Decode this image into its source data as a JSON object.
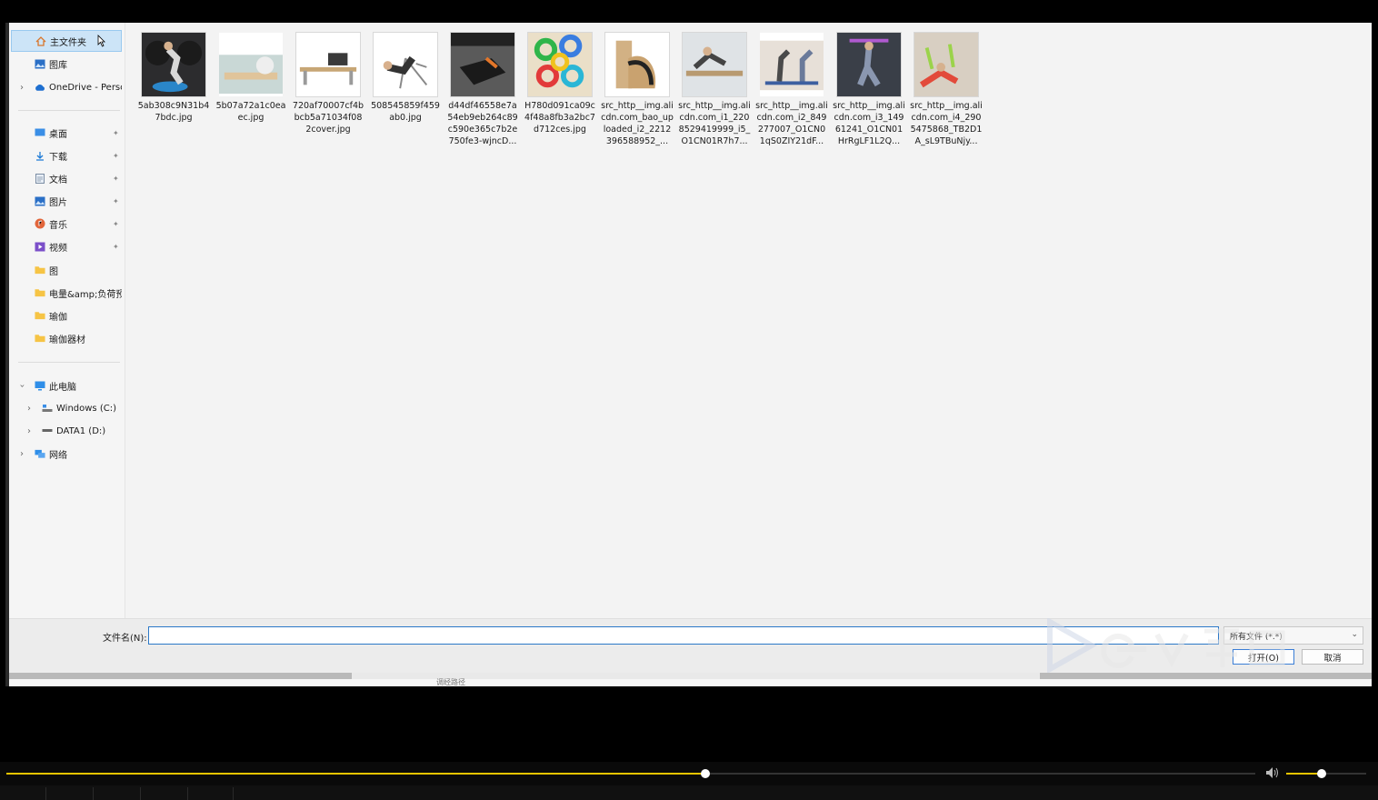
{
  "nav": {
    "quick": [
      {
        "label": "主文件夹",
        "icon": "home-icon"
      },
      {
        "label": "图库",
        "icon": "gallery-icon"
      },
      {
        "label": "OneDrive - Perso",
        "icon": "cloud-icon"
      }
    ],
    "pinned": [
      {
        "label": "桌面",
        "icon": "desktop-icon"
      },
      {
        "label": "下载",
        "icon": "download-icon"
      },
      {
        "label": "文档",
        "icon": "document-icon"
      },
      {
        "label": "图片",
        "icon": "pictures-icon"
      },
      {
        "label": "音乐",
        "icon": "music-icon"
      },
      {
        "label": "视频",
        "icon": "video-icon"
      },
      {
        "label": "图",
        "icon": "folder-icon"
      },
      {
        "label": "电量&amp;负荷预",
        "icon": "folder-icon"
      },
      {
        "label": "瑜伽",
        "icon": "folder-icon"
      },
      {
        "label": "瑜伽器材",
        "icon": "folder-icon"
      }
    ],
    "pc": [
      {
        "label": "此电脑",
        "icon": "computer-icon"
      },
      {
        "label": "Windows (C:)",
        "icon": "drive-icon"
      },
      {
        "label": "DATA1 (D:)",
        "icon": "drive-icon"
      },
      {
        "label": "网络",
        "icon": "network-icon"
      }
    ]
  },
  "files": [
    {
      "name": "5ab308c9N31b47bdc.jpg"
    },
    {
      "name": "5b07a72a1c0eaec.jpg"
    },
    {
      "name": "720af70007cf4bbcb5a71034f082cover.jpg"
    },
    {
      "name": "508545859f459ab0.jpg"
    },
    {
      "name": "d44df46558e7a54eb9eb264c89c590e365c7b2e750fe3-wjncD..."
    },
    {
      "name": "H780d091ca09c4f48a8fb3a2bc7d712ces.jpg"
    },
    {
      "name": "src_http__img.alicdn.com_bao_uploaded_i2_2212396588952_..."
    },
    {
      "name": "src_http__img.alicdn.com_i1_2208529419999_i5_O1CN01R7h7..."
    },
    {
      "name": "src_http__img.alicdn.com_i2_849277007_O1CN01qS0ZIY21dF..."
    },
    {
      "name": "src_http__img.alicdn.com_i3_14961241_O1CN01HrRgLF1L2Q..."
    },
    {
      "name": "src_http__img.alicdn.com_i4_2905475868_TB2D1A_sL9TBuNjy..."
    }
  ],
  "bottom": {
    "filename_label": "文件名(N):",
    "filename_value": "",
    "filetype_value": "所有文件 (*.*)",
    "open_label": "打开(O)",
    "cancel_label": "取消"
  },
  "status": {
    "text": "调经路径"
  },
  "player": {
    "progress": 0.56,
    "volume": 0.44,
    "accent": "#e8c400"
  }
}
